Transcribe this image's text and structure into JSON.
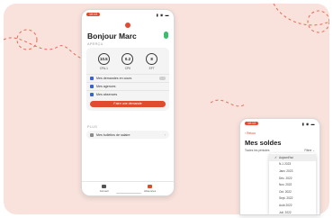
{
  "colors": {
    "accent": "#e04a2f",
    "background": "#f9e2dc",
    "success": "#3dbb6e",
    "link": "#3a63c8"
  },
  "main_phone": {
    "status": {
      "time": "10:13",
      "icons": "▮ ◉ ▬"
    },
    "greeting": "Bonjour Marc",
    "overview_label": "APERÇU",
    "stats": [
      {
        "value": "10.5",
        "label": "CPA-1"
      },
      {
        "value": "0.2",
        "label": "CPK"
      },
      {
        "value": "8",
        "label": "EFT"
      }
    ],
    "rows": [
      {
        "label": "Mes demandes en cours",
        "icon": "document-icon"
      },
      {
        "label": "Mes agences",
        "icon": "building-icon"
      },
      {
        "label": "Mes absences",
        "icon": "calendar-icon"
      }
    ],
    "cta_label": "Faire une demande",
    "more_label": "PLUS",
    "bulletin_row": "Mes bulletins de salaire",
    "chevron": "›",
    "tabs": [
      {
        "label": "Accueil",
        "icon": "home-icon"
      },
      {
        "label": "Absences",
        "icon": "plane-icon"
      }
    ]
  },
  "second_phone": {
    "back_label": "‹ Retour",
    "title": "Mes soldes",
    "filter_left": "Toutes les périodes",
    "filter_right": "Filtrer ⌄",
    "check": "✓",
    "options": [
      {
        "label": "Aujourd'hui",
        "selected": true
      },
      {
        "label": "N-1 2023",
        "selected": false
      },
      {
        "label": "Janv. 2023",
        "selected": false
      },
      {
        "label": "Déc. 2022",
        "selected": false
      },
      {
        "label": "Nov. 2022",
        "selected": false
      },
      {
        "label": "Oct. 2022",
        "selected": false
      },
      {
        "label": "Sept. 2022",
        "selected": false
      },
      {
        "label": "Août 2022",
        "selected": false
      },
      {
        "label": "Juil. 2022",
        "selected": false
      }
    ]
  }
}
